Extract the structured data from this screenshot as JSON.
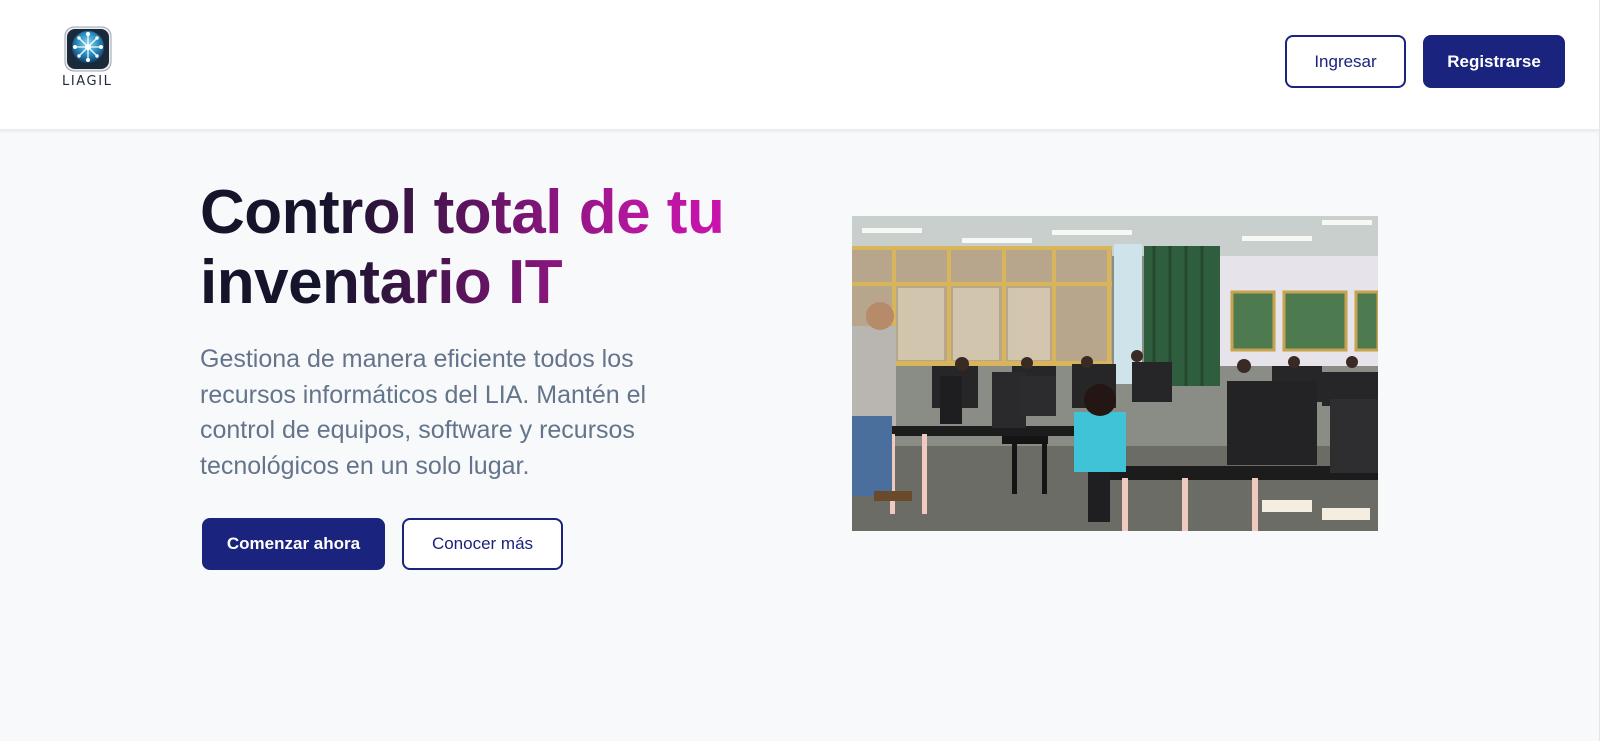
{
  "header": {
    "logo_text": "LIAGIL",
    "login_label": "Ingresar",
    "register_label": "Registrarse"
  },
  "hero": {
    "title": "Control total de tu inventario IT",
    "description": "Gestiona de manera eficiente todos los recursos informáticos del LIA. Mantén el control de equipos, software y recursos tecnológicos en un solo lugar.",
    "primary_cta": "Comenzar ahora",
    "secondary_cta": "Conocer más",
    "image_icon": "classroom-photo"
  },
  "colors": {
    "brand": "#1a237e",
    "title_dark": "#14142b",
    "title_accent": "#d111b4",
    "body_text": "#64748b",
    "page_bg": "#f8f9fb"
  }
}
